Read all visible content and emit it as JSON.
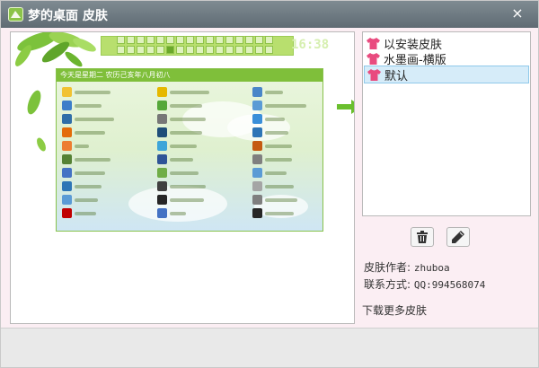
{
  "window": {
    "title": "梦的桌面 皮肤",
    "close_label": "×"
  },
  "preview": {
    "clock": "16:38",
    "menu_title": "今天是星期二 农历己亥年八月初八"
  },
  "skins": [
    {
      "name": "以安装皮肤",
      "selected": false
    },
    {
      "name": "水墨画-横版",
      "selected": false
    },
    {
      "name": "默认",
      "selected": true
    }
  ],
  "actions": {
    "delete_icon": "trash-icon",
    "edit_icon": "pencil-icon"
  },
  "info": {
    "author_label": "皮肤作者:",
    "author_value": "zhuboa",
    "contact_label": "联系方式:",
    "contact_value": "QQ:994568074"
  },
  "more_link": "下载更多皮肤",
  "colors": {
    "titlebar": "#6f7b83",
    "accent_green": "#7fbf3a",
    "selected_bg": "#d6ecf9",
    "shirt_pink": "#e94b7f"
  }
}
